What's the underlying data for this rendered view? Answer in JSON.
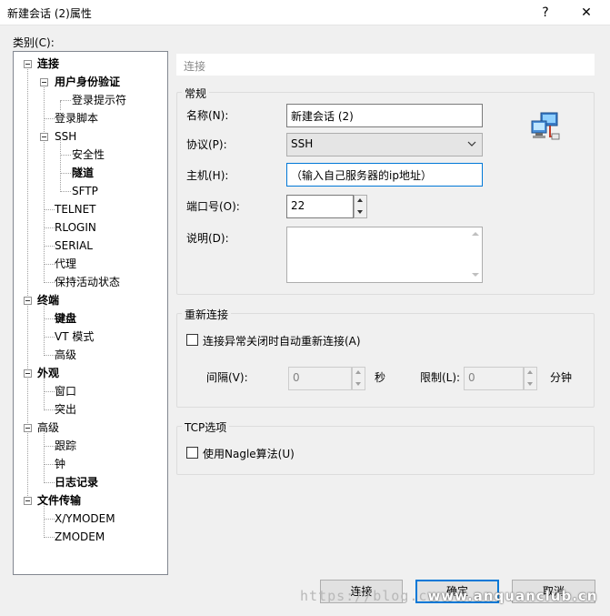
{
  "window": {
    "title": "新建会话 (2)属性",
    "help_label": "?",
    "close_label": "✕"
  },
  "category_label": "类别(C):",
  "tree": {
    "connection": "连接",
    "user_auth": "用户身份验证",
    "login_prompt": "登录提示符",
    "login_script": "登录脚本",
    "ssh": "SSH",
    "security": "安全性",
    "tunnel": "隧道",
    "sftp": "SFTP",
    "telnet": "TELNET",
    "rlogin": "RLOGIN",
    "serial": "SERIAL",
    "proxy": "代理",
    "keepalive": "保持活动状态",
    "terminal": "终端",
    "keyboard": "键盘",
    "vt_mode": "VT 模式",
    "advanced1": "高级",
    "appearance": "外观",
    "window": "窗口",
    "highlight": "突出",
    "advanced": "高级",
    "trace": "跟踪",
    "bell": "钟",
    "logging": "日志记录",
    "file_transfer": "文件传输",
    "xymodem": "X/YMODEM",
    "zmodem": "ZMODEM"
  },
  "pane_header": "连接",
  "general": {
    "legend": "常规",
    "name_label": "名称(N):",
    "name_value": "新建会话 (2)",
    "protocol_label": "协议(P):",
    "protocol_value": "SSH",
    "host_label": "主机(H):",
    "host_value": "（输入自己服务器的ip地址）",
    "port_label": "端口号(O):",
    "port_value": "22",
    "desc_label": "说明(D):",
    "desc_value": ""
  },
  "reconnect": {
    "legend": "重新连接",
    "auto_label": "连接异常关闭时自动重新连接(A)",
    "auto_checked": false,
    "interval_label": "间隔(V):",
    "interval_value": "0",
    "interval_unit": "秒",
    "limit_label": "限制(L):",
    "limit_value": "0",
    "limit_unit": "分钟"
  },
  "tcp": {
    "legend": "TCP选项",
    "nagle_label": "使用Nagle算法(U)",
    "nagle_checked": false
  },
  "buttons": {
    "connect": "连接",
    "ok": "确定",
    "cancel": "取消"
  },
  "watermark": {
    "url": "https://blog.c",
    "site": "www.anquanclub.cn"
  },
  "icons": {
    "session": "network-computers-icon"
  }
}
